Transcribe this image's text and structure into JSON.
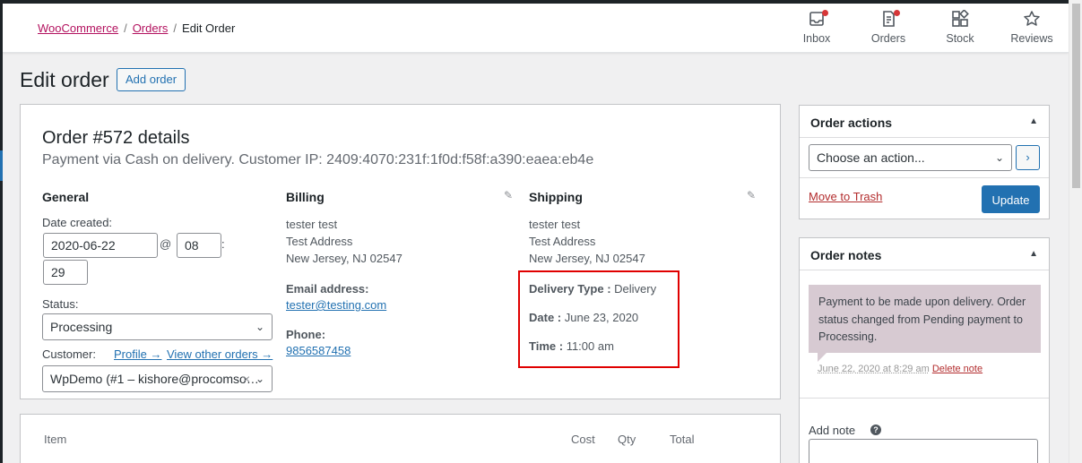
{
  "breadcrumb": {
    "root": "WooCommerce",
    "orders": "Orders",
    "current": "Edit Order"
  },
  "header_nav": [
    {
      "label": "Inbox",
      "icon": "inbox-icon"
    },
    {
      "label": "Orders",
      "icon": "orders-icon"
    },
    {
      "label": "Stock",
      "icon": "stock-icon"
    },
    {
      "label": "Reviews",
      "icon": "star-icon"
    }
  ],
  "page": {
    "title": "Edit order",
    "add_button": "Add order"
  },
  "order": {
    "heading": "Order #572 details",
    "subtitle": "Payment via Cash on delivery. Customer IP: 2409:4070:231f:1f0d:f58f:a390:eaea:eb4e"
  },
  "general": {
    "title": "General",
    "date_label": "Date created:",
    "date_value": "2020-06-22",
    "at": "@",
    "hour": "08",
    "colon": ":",
    "minute": "29",
    "status_label": "Status:",
    "status_value": "Processing",
    "customer_label": "Customer:",
    "profile_link": "Profile →",
    "other_orders_link": "View other orders →",
    "customer_value": "WpDemo (#1 – kishore@procomso…",
    "clear": "×"
  },
  "billing": {
    "title": "Billing",
    "name": "tester test",
    "address": "Test Address",
    "city": "New Jersey, NJ 02547",
    "email_label": "Email address:",
    "email": "tester@testing.com",
    "phone_label": "Phone:",
    "phone": "9856587458"
  },
  "shipping": {
    "title": "Shipping",
    "name": "tester test",
    "address": "Test Address",
    "city": "New Jersey, NJ 02547",
    "delivery_type_label": "Delivery Type :",
    "delivery_type": "Delivery",
    "date_label": "Date :",
    "date": "June 23, 2020",
    "time_label": "Time :",
    "time": "11:00 am"
  },
  "items_table": {
    "headers": [
      "Item",
      "Cost",
      "Qty",
      "Total"
    ]
  },
  "order_actions": {
    "title": "Order actions",
    "select_value": "Choose an action...",
    "go": "›",
    "trash": "Move to Trash",
    "update": "Update"
  },
  "order_notes": {
    "title": "Order notes",
    "note_text": "Payment to be made upon delivery. Order status changed from Pending payment to Processing.",
    "note_date": "June 22, 2020 at 8:29 am",
    "delete": "Delete note",
    "add_note_label": "Add note",
    "help": "?"
  },
  "colors": {
    "accent": "#2271b1",
    "brand": "#b3125f",
    "highlight": "#e00000",
    "note_bg": "#d7cad2"
  }
}
